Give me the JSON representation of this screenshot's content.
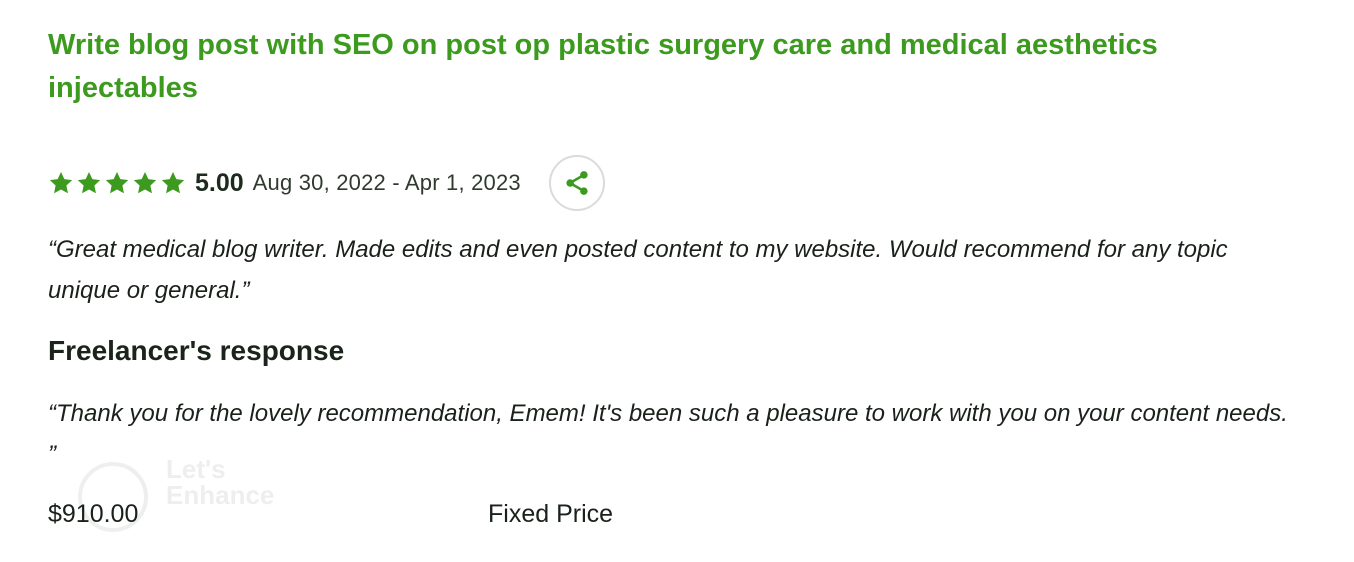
{
  "job": {
    "title": "Write blog post with SEO on post op plastic surgery care and medical aesthetics injectables"
  },
  "rating": {
    "stars": 5,
    "value": "5.00",
    "date_range": "Aug 30, 2022 - Apr 1, 2023"
  },
  "share": {
    "icon": "share-icon"
  },
  "review": {
    "client_text": "“Great medical blog writer. Made edits and even posted content to my website. Would recommend for any topic unique or general.”"
  },
  "response": {
    "heading": "Freelancer's response",
    "text": "“Thank you for the lovely recommendation, Emem! It's been such a pleasure to work with you on your content needs. ”"
  },
  "contract": {
    "price": "$910.00",
    "type": "Fixed Price"
  },
  "watermark": {
    "text": "Let's\nEnhance"
  },
  "colors": {
    "accent": "#3c9b1e",
    "star": "#3c9b1e",
    "text": "#1a201a",
    "share_border": "#d9dcd9"
  }
}
